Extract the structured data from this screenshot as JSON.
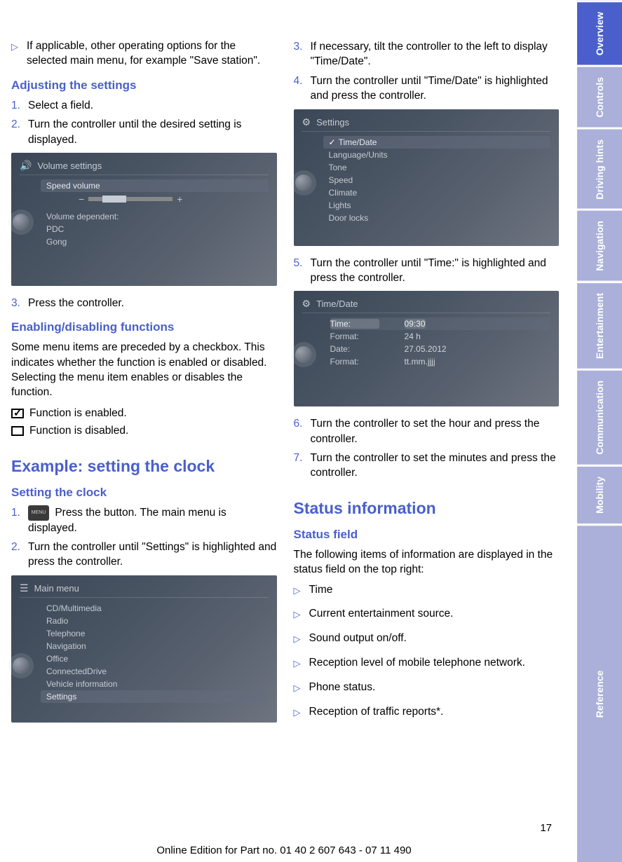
{
  "col1": {
    "intro": "If applicable, other operating options for the selected main menu, for example \"Save station\".",
    "h_adjust": "Adjusting the settings",
    "adj": [
      "Select a field.",
      "Turn the controller until the desired setting is displayed."
    ],
    "shot1": {
      "title": "Volume settings",
      "sel": "Speed volume",
      "dep": "Volume dependent:",
      "r1": "PDC",
      "r2": "Gong"
    },
    "adj3": "Press the controller.",
    "h_enable": "Enabling/disabling functions",
    "enable_p": "Some menu items are preceded by a checkbox. This indicates whether the function is enabled or disabled. Selecting the menu item enables or disables the function.",
    "fn_en": "Function is enabled.",
    "fn_dis": "Function is disabled.",
    "h_example": "Example: setting the clock",
    "h_setclock": "Setting the clock",
    "menu_label": "MENU",
    "step1": "Press the button. The main menu is displayed.",
    "step2": "Turn the controller until \"Settings\" is highlighted and press the controller.",
    "shot2": {
      "title": "Main menu",
      "items": [
        "CD/Multimedia",
        "Radio",
        "Telephone",
        "Navigation",
        "Office",
        "ConnectedDrive",
        "Vehicle information",
        "Settings"
      ],
      "sel_idx": 7
    }
  },
  "col2": {
    "step3": "If necessary, tilt the controller to the left to display \"Time/Date\".",
    "step4": "Turn the controller until \"Time/Date\" is highlighted and press the controller.",
    "shot3": {
      "title": "Settings",
      "items": [
        "Time/Date",
        "Language/Units",
        "Tone",
        "Speed",
        "Climate",
        "Lights",
        "Door locks"
      ],
      "sel_idx": 0
    },
    "step5": "Turn the controller until \"Time:\" is highlighted and press the controller.",
    "shot4": {
      "title": "Time/Date",
      "rows": [
        {
          "k": "Time:",
          "v": "09:30"
        },
        {
          "k": "Format:",
          "v": "24 h"
        },
        {
          "k": "Date:",
          "v": "27.05.2012"
        },
        {
          "k": "Format:",
          "v": "tt.mm.jjjj"
        }
      ],
      "sel_idx": 0
    },
    "step6": "Turn the controller to set the hour and press the controller.",
    "step7": "Turn the controller to set the minutes and press the controller.",
    "h_status": "Status information",
    "h_statusfield": "Status field",
    "status_p": "The following items of information are displayed in the status field on the top right:",
    "bul": [
      "Time",
      "Current entertainment source.",
      "Sound output on/off.",
      "Reception level of mobile telephone network.",
      "Phone status.",
      "Reception of traffic reports*."
    ]
  },
  "tabs": [
    "Overview",
    "Controls",
    "Driving hints",
    "Navigation",
    "Entertainment",
    "Communication",
    "Mobility",
    "Reference"
  ],
  "page": "17",
  "footer": "Online Edition for Part no. 01 40 2 607 643 - 07 11 490"
}
